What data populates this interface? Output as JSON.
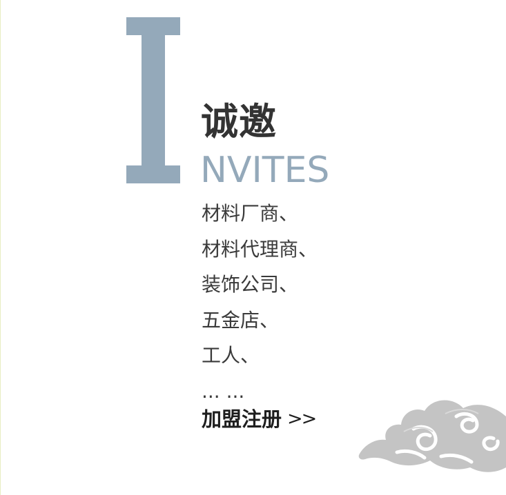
{
  "hero": {
    "big_letter": "I",
    "title_cn": "诚邀",
    "title_en": "NVITES",
    "letter_color": "#94a9ba"
  },
  "invite_list": [
    "材料厂商、",
    "材料代理商、",
    "装饰公司、",
    "五金店、",
    "工人、",
    "... ..."
  ],
  "register": {
    "label": "加盟注册",
    "arrow": ">>"
  },
  "decoration": {
    "icon": "cloud-icon",
    "color": "#c4c4c4"
  }
}
